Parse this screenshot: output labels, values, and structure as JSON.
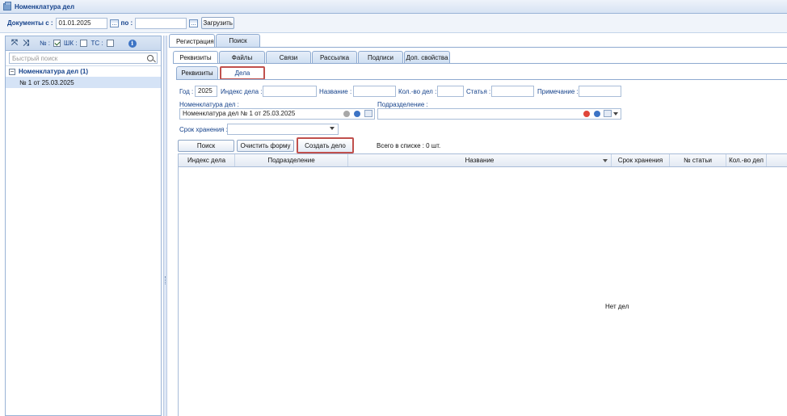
{
  "window": {
    "title": "Номенклатура дел"
  },
  "topbar": {
    "docs_from_label": "Документы с :",
    "date_from": "01.01.2025",
    "to_label": "по :",
    "date_to": "",
    "load_button": "Загрузить"
  },
  "left": {
    "toolbar": {
      "num_label": "№ :",
      "shk_label": "ШК :",
      "tc_label": "ТС :",
      "num_checked": true,
      "tc_checked": false
    },
    "search_placeholder": "Быстрый поиск",
    "tree_header": "Номенклатура дел (1)",
    "tree_items": [
      "№ 1 от 25.03.2025"
    ]
  },
  "tabs_top": [
    "Регистрация",
    "Поиск"
  ],
  "tabs_second": [
    "Реквизиты",
    "Файлы",
    "Связи",
    "Рассылка",
    "Подписи",
    "Доп. свойства"
  ],
  "tabs_third": [
    "Реквизиты",
    "Дела"
  ],
  "filter": {
    "year_label": "Год :",
    "year_value": "2025",
    "index_label": "Индекс дела :",
    "name_label": "Название :",
    "count_label": "Кол.-во дел :",
    "article_label": "Статья :",
    "note_label": "Примечание :",
    "nomenclature_label": "Номенклатура дел :",
    "nomenclature_value": "Номенклатура дел № 1 от 25.03.2025",
    "division_label": "Подразделение :",
    "retention_label": "Срок хранения :"
  },
  "actions": {
    "search_button": "Поиск",
    "clear_button": "Очистить форму",
    "create_button": "Создать дело",
    "total_text": "Всего в списке : 0 шт."
  },
  "grid": {
    "columns": [
      "Индекс дела",
      "Подразделение",
      "Название",
      "Срок хранения",
      "№ статьи",
      "Кол.-во дел"
    ],
    "empty_text": "Нет дел"
  },
  "colors": {
    "accent": "#15428b",
    "highlight_border": "#c0504d",
    "selected_row": "#d5e3f6"
  }
}
